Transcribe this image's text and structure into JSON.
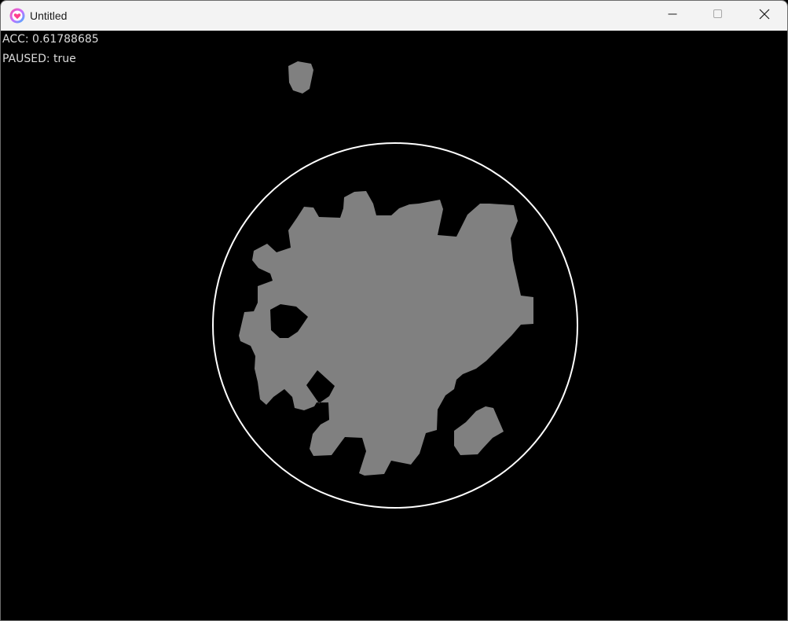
{
  "window": {
    "title": "Untitled",
    "app_icon": "heart-app-icon",
    "controls": {
      "minimize_icon": "minimize-icon",
      "maximize_icon": "maximize-icon",
      "close_icon": "close-icon"
    }
  },
  "hud": {
    "acc_label": "ACC: 0.61788685",
    "paused_label": "PAUSED: true"
  },
  "game": {
    "background_color": "#000000",
    "blob_color": "#808080",
    "boundary_color": "#ffffff",
    "paused": true,
    "acc": 0.61788685
  }
}
